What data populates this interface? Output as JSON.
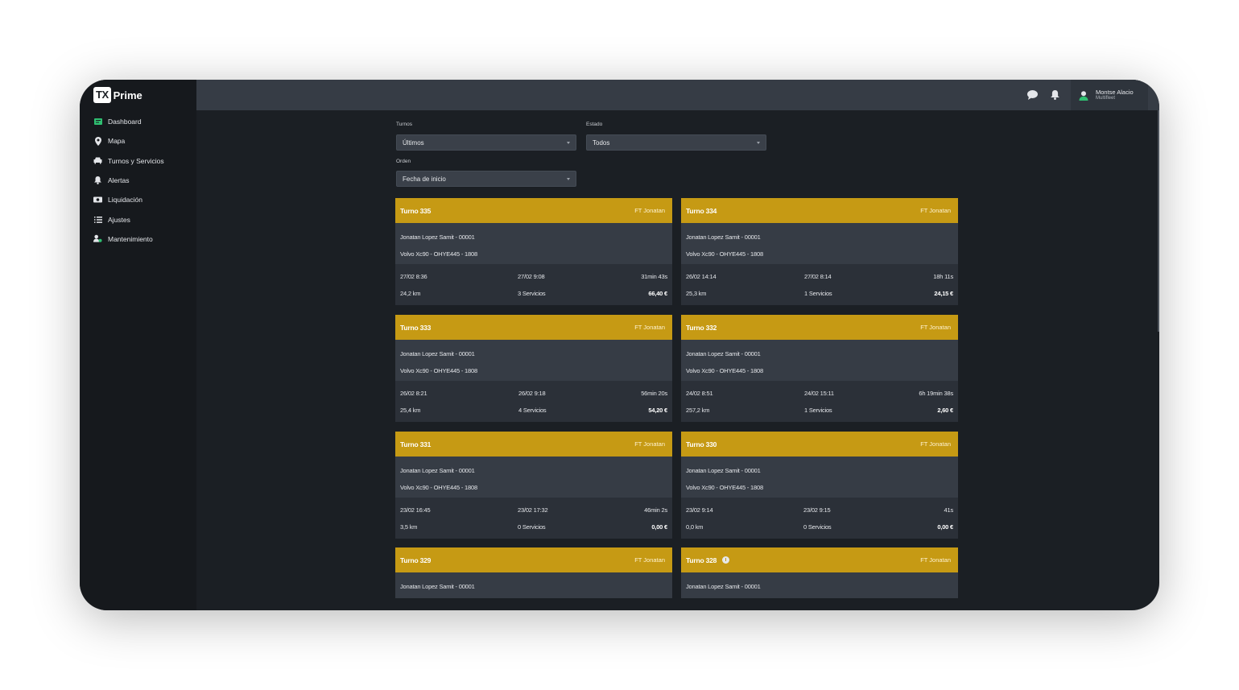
{
  "app": {
    "logo_badge": "TX",
    "logo_text": "Prime"
  },
  "sidebar": {
    "items": [
      {
        "label": "Dashboard",
        "icon": "dashboard-icon"
      },
      {
        "label": "Mapa",
        "icon": "map-pin-icon"
      },
      {
        "label": "Turnos y Servicios",
        "icon": "car-icon"
      },
      {
        "label": "Alertas",
        "icon": "bell-icon"
      },
      {
        "label": "Liquidación",
        "icon": "money-icon"
      },
      {
        "label": "Ajustes",
        "icon": "list-icon"
      },
      {
        "label": "Mantenimiento",
        "icon": "user-gear-icon"
      }
    ]
  },
  "topbar": {
    "user_name": "Montse Alacio",
    "user_role": "Multifleet"
  },
  "filters": {
    "turnos_label": "Turnos",
    "turnos_value": "Últimos",
    "estado_label": "Estado",
    "estado_value": "Todos",
    "orden_label": "Orden",
    "orden_value": "Fecha de inicio"
  },
  "cards": [
    {
      "title": "Turno 335",
      "driver_tag": "FT Jonatan",
      "driver": "Jonatan Lopez Samit - 00001",
      "vehicle": "Volvo Xc90 - OHYE445 - 1808",
      "start": "27/02 8:36",
      "end": "27/02 9:08",
      "duration": "31min 43s",
      "distance": "24,2 km",
      "services": "3 Servicios",
      "amount": "66,40 €"
    },
    {
      "title": "Turno 334",
      "driver_tag": "FT Jonatan",
      "driver": "Jonatan Lopez Samit - 00001",
      "vehicle": "Volvo Xc90 - OHYE445 - 1808",
      "start": "26/02 14:14",
      "end": "27/02 8:14",
      "duration": "18h 11s",
      "distance": "25,3 km",
      "services": "1 Servicios",
      "amount": "24,15 €"
    },
    {
      "title": "Turno 333",
      "driver_tag": "FT Jonatan",
      "driver": "Jonatan Lopez Samit - 00001",
      "vehicle": "Volvo Xc90 - OHYE445 - 1808",
      "start": "26/02 8:21",
      "end": "26/02 9:18",
      "duration": "56min 20s",
      "distance": "25,4 km",
      "services": "4 Servicios",
      "amount": "54,20 €"
    },
    {
      "title": "Turno 332",
      "driver_tag": "FT Jonatan",
      "driver": "Jonatan Lopez Samit - 00001",
      "vehicle": "Volvo Xc90 - OHYE445 - 1808",
      "start": "24/02 8:51",
      "end": "24/02 15:11",
      "duration": "6h 19min 38s",
      "distance": "257,2 km",
      "services": "1 Servicios",
      "amount": "2,60 €"
    },
    {
      "title": "Turno 331",
      "driver_tag": "FT Jonatan",
      "driver": "Jonatan Lopez Samit - 00001",
      "vehicle": "Volvo Xc90 - OHYE445 - 1808",
      "start": "23/02 16:45",
      "end": "23/02 17:32",
      "duration": "46min 2s",
      "distance": "3,5 km",
      "services": "0 Servicios",
      "amount": "0,00 €"
    },
    {
      "title": "Turno 330",
      "driver_tag": "FT Jonatan",
      "driver": "Jonatan Lopez Samit - 00001",
      "vehicle": "Volvo Xc90 - OHYE445 - 1808",
      "start": "23/02 9:14",
      "end": "23/02 9:15",
      "duration": "41s",
      "distance": "0,0 km",
      "services": "0 Servicios",
      "amount": "0,00 €"
    },
    {
      "title": "Turno 329",
      "driver_tag": "FT Jonatan",
      "driver": "Jonatan Lopez Samit - 00001"
    },
    {
      "title": "Turno 328",
      "driver_tag": "FT Jonatan",
      "driver": "Jonatan Lopez Samit - 00001",
      "info_icon": "info-icon"
    }
  ],
  "colors": {
    "accent": "#c69a14",
    "sidebar_bg": "#16191d",
    "topbar_bg": "#363c45",
    "card_body": "#363c45",
    "card_foot": "#2b3038",
    "app_bg": "#1b1f24"
  }
}
